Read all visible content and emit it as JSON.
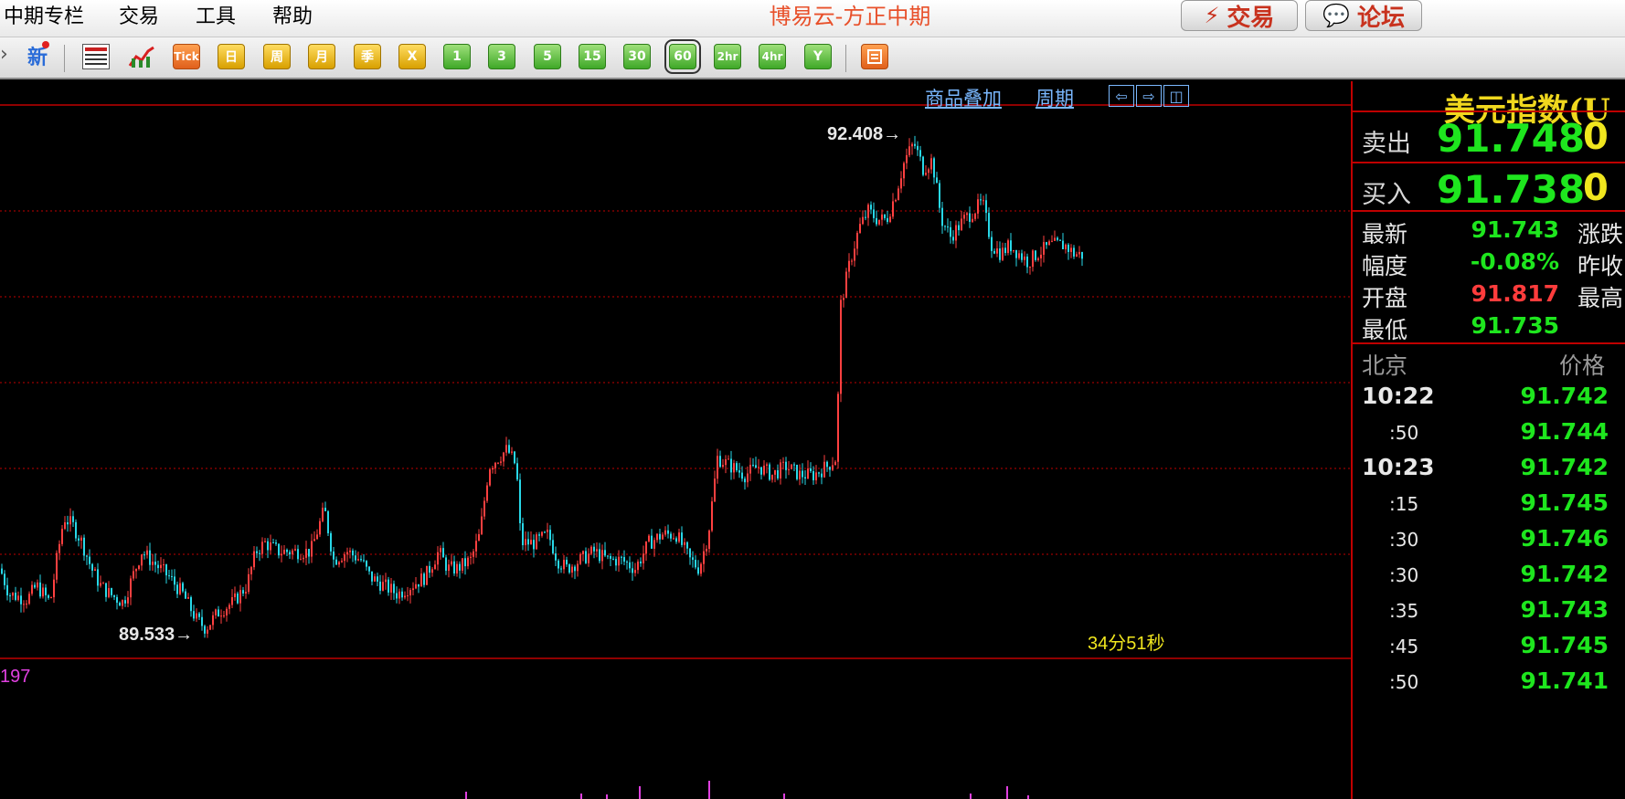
{
  "menu": {
    "items": [
      "中期专栏",
      "交易",
      "工具",
      "帮助"
    ]
  },
  "app_title": "博易云-方正中期",
  "top_buttons": {
    "trade": "交易",
    "forum": "论坛"
  },
  "toolbar": {
    "new_label": "新",
    "buttons": [
      "Tick",
      "日",
      "周",
      "月",
      "季",
      "X",
      "1",
      "3",
      "5",
      "15",
      "30",
      "60",
      "2hr",
      "4hr",
      "Y"
    ],
    "selected": "60"
  },
  "chart_links": {
    "overlay": "商品叠加",
    "period": "周期"
  },
  "chart": {
    "high_label": "92.408",
    "low_label": "89.533",
    "countdown": "34分51秒",
    "volume_value": "197",
    "colors": {
      "up": "#ff4040",
      "down": "#28d8e8",
      "grid": "#c00000",
      "volume": "#e040e0"
    }
  },
  "chart_data": {
    "type": "candlestick",
    "high": 92.408,
    "low": 89.533,
    "series_outline": [
      [
        0,
        89.9
      ],
      [
        10,
        89.75
      ],
      [
        30,
        89.72
      ],
      [
        40,
        89.8
      ],
      [
        55,
        89.7
      ],
      [
        62,
        89.95
      ],
      [
        70,
        90.2
      ],
      [
        80,
        90.15
      ],
      [
        90,
        90.05
      ],
      [
        100,
        89.9
      ],
      [
        110,
        89.8
      ],
      [
        120,
        89.75
      ],
      [
        135,
        89.7
      ],
      [
        145,
        89.85
      ],
      [
        155,
        90.0
      ],
      [
        165,
        89.95
      ],
      [
        175,
        89.9
      ],
      [
        185,
        89.85
      ],
      [
        200,
        89.75
      ],
      [
        215,
        89.6
      ],
      [
        225,
        89.55
      ],
      [
        240,
        89.65
      ],
      [
        255,
        89.7
      ],
      [
        270,
        89.8
      ],
      [
        280,
        90.0
      ],
      [
        290,
        90.05
      ],
      [
        305,
        90.0
      ],
      [
        320,
        90.0
      ],
      [
        340,
        90.0
      ],
      [
        355,
        90.25
      ],
      [
        365,
        89.95
      ],
      [
        380,
        90.0
      ],
      [
        395,
        89.95
      ],
      [
        405,
        89.85
      ],
      [
        420,
        89.8
      ],
      [
        435,
        89.75
      ],
      [
        450,
        89.8
      ],
      [
        465,
        89.85
      ],
      [
        480,
        90.0
      ],
      [
        490,
        89.9
      ],
      [
        500,
        89.9
      ],
      [
        515,
        89.95
      ],
      [
        525,
        90.1
      ],
      [
        535,
        90.5
      ],
      [
        545,
        90.55
      ],
      [
        555,
        90.6
      ],
      [
        565,
        90.5
      ],
      [
        570,
        90.05
      ],
      [
        585,
        90.05
      ],
      [
        600,
        90.1
      ],
      [
        610,
        89.95
      ],
      [
        620,
        89.9
      ],
      [
        635,
        89.95
      ],
      [
        650,
        90.0
      ],
      [
        665,
        89.95
      ],
      [
        680,
        89.95
      ],
      [
        695,
        89.9
      ],
      [
        710,
        90.05
      ],
      [
        725,
        90.1
      ],
      [
        740,
        90.1
      ],
      [
        755,
        89.95
      ],
      [
        765,
        89.9
      ],
      [
        775,
        90.1
      ],
      [
        785,
        90.55
      ],
      [
        800,
        90.5
      ],
      [
        815,
        90.45
      ],
      [
        830,
        90.5
      ],
      [
        845,
        90.45
      ],
      [
        860,
        90.5
      ],
      [
        875,
        90.45
      ],
      [
        890,
        90.45
      ],
      [
        905,
        90.5
      ],
      [
        915,
        90.55
      ],
      [
        920,
        91.45
      ],
      [
        930,
        91.7
      ],
      [
        940,
        91.9
      ],
      [
        950,
        92.0
      ],
      [
        960,
        91.95
      ],
      [
        970,
        91.95
      ],
      [
        980,
        92.1
      ],
      [
        990,
        92.3
      ],
      [
        1000,
        92.4
      ],
      [
        1010,
        92.25
      ],
      [
        1020,
        92.3
      ],
      [
        1030,
        91.95
      ],
      [
        1040,
        91.85
      ],
      [
        1055,
        91.95
      ],
      [
        1065,
        92.0
      ],
      [
        1075,
        92.05
      ],
      [
        1085,
        91.8
      ],
      [
        1095,
        91.75
      ],
      [
        1105,
        91.8
      ],
      [
        1115,
        91.75
      ],
      [
        1125,
        91.7
      ],
      [
        1135,
        91.75
      ],
      [
        1150,
        91.8
      ],
      [
        1165,
        91.8
      ],
      [
        1175,
        91.75
      ],
      [
        1185,
        91.74
      ]
    ]
  },
  "symbol": "美元指数(U",
  "quotes": {
    "sell_label": "卖出",
    "sell_price": "91.748",
    "sell_vol": "0",
    "buy_label": "买入",
    "buy_price": "91.738",
    "buy_vol": "0"
  },
  "stats": {
    "latest_label": "最新",
    "latest_value": "91.743",
    "change_label": "涨跌",
    "range_label": "幅度",
    "range_value": "-0.08%",
    "prev_close_label": "昨收",
    "open_label": "开盘",
    "open_value": "91.817",
    "high_label": "最高",
    "low_label": "最低",
    "low_value": "91.735"
  },
  "ticks": {
    "header_time": "北京",
    "header_price": "价格",
    "rows": [
      {
        "time": "10:22",
        "price": "91.742",
        "major": true
      },
      {
        "time": ":50",
        "price": "91.744",
        "major": false
      },
      {
        "time": "10:23",
        "price": "91.742",
        "major": true
      },
      {
        "time": ":15",
        "price": "91.745",
        "major": false
      },
      {
        "time": ":30",
        "price": "91.746",
        "major": false
      },
      {
        "time": ":30",
        "price": "91.742",
        "major": false
      },
      {
        "time": ":35",
        "price": "91.743",
        "major": false
      },
      {
        "time": ":45",
        "price": "91.745",
        "major": false
      },
      {
        "time": ":50",
        "price": "91.741",
        "major": false
      }
    ]
  }
}
